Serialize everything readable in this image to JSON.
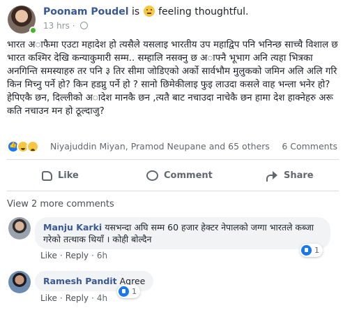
{
  "post": {
    "author": "Poonam Poudel",
    "is_word": "is",
    "feeling": "feeling thoughtful.",
    "time": "13 hrs",
    "text": "भारत अाफैमा एउटा महादेश हो त्यसैले यसलाइ भारतीय उप महाद्विप पनि भनिन्छ साच्चै विशाल छ भारत कश्मिर देखि कन्याकुमारी सम्म.. सम्हालि नसक्नु छ अाफ्नै भूभाग अनि त्यहा भित्रका अनगिन्ति समस्याहरु तर पनि ३ तिर सीमा जोडिएको अर्को सार्वभौम मुलुकको जमिन अलि अलि गरि किन मिच्नु पर्ने हो? किन हडप्नु पर्ने हो ? सानो छिमेकीलाइ फुइ लाउदा कसले वाह भन्ला भनेर हो? हेपिएकै छन, दिल्लीको अादेश मानकै छन ,त्यतै बाट नचाउदा नाचेकै छन हामा देश हाक्नेहरु अरू कति नचाउन मन हो ठूल्दाजु?"
  },
  "reactions": {
    "names": "Niyajuddin Miyan, Pramod Neupane and 65 others",
    "comments_count": "6 Comments"
  },
  "actions": {
    "like": "Like",
    "comment": "Comment",
    "share": "Share"
  },
  "view_more": "View 2 more comments",
  "comments": [
    {
      "name": "Manju Karki",
      "text": "यसभन्दा अघि सम्म 60 हजार हेक्टर नेपालको जग्गा भारतले कब्जा गरेको तत्थाक थियाँ । कोही बोल्दैन",
      "like": "Like",
      "reply": "Reply",
      "time": "6h",
      "reaction_count": "1"
    },
    {
      "name": "Ramesh Pandit",
      "text": "Agree",
      "like": "Like",
      "reply": "Reply",
      "time": "4h",
      "reaction_count": "1"
    }
  ]
}
